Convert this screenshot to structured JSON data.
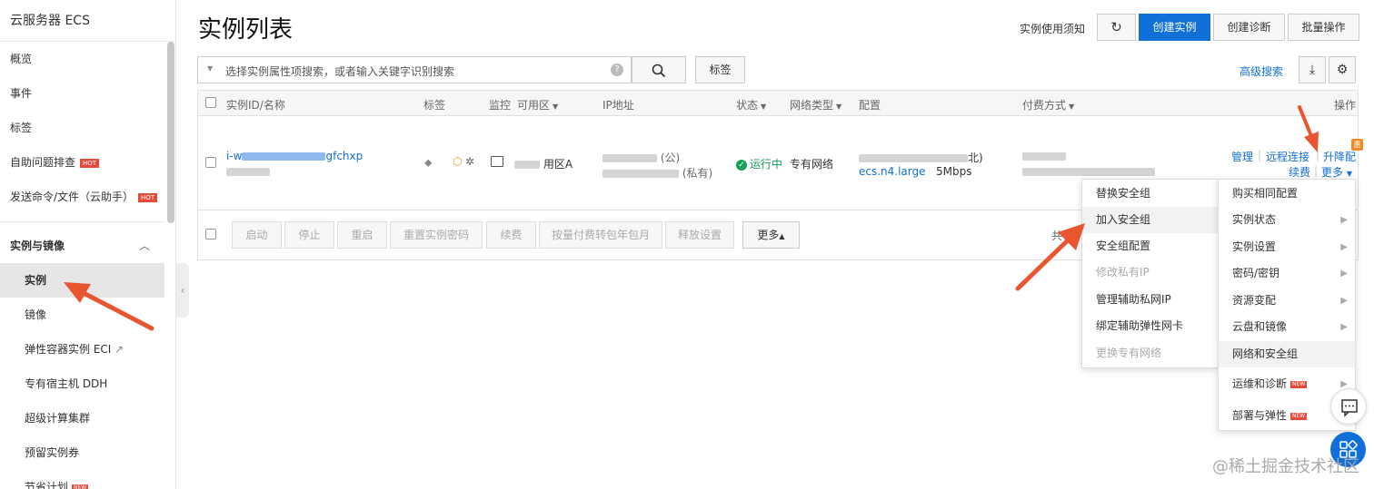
{
  "sidebar": {
    "title": "云服务器 ECS",
    "items": [
      "概览",
      "事件",
      "标签",
      "自助问题排查",
      "发送命令/文件（云助手）"
    ],
    "hot_badge": "HOT",
    "section": "实例与镜像",
    "sub_items": [
      "实例",
      "镜像",
      "弹性容器实例 ECI",
      "专有宿主机 DDH",
      "超级计算集群",
      "预留实例券",
      "节省计划"
    ],
    "new_badge": "NEW"
  },
  "header": {
    "title": "实例列表",
    "notice_link": "实例使用须知",
    "refresh_icon": "↻",
    "create_button": "创建实例",
    "diagnose_button": "创建诊断",
    "batch_button": "批量操作"
  },
  "search": {
    "placeholder": "选择实例属性项搜索，或者输入关键字识别搜索",
    "help_icon": "?",
    "tag_button": "标签",
    "advanced_link": "高级搜索"
  },
  "table": {
    "headers": {
      "id_name": "实例ID/名称",
      "tags": "标签",
      "monitor": "监控",
      "zone": "可用区",
      "ip": "IP地址",
      "status": "状态",
      "network": "网络类型",
      "config": "配置",
      "billing": "付费方式",
      "actions": "操作"
    },
    "row": {
      "id_prefix": "i-w",
      "id_suffix": "gfchxp",
      "zone_suffix": "用区A",
      "ip_public": "(公)",
      "ip_private": "(私有)",
      "status": "运行中",
      "network": "专有网络",
      "config_suffix": "北)",
      "instance_type": "ecs.n4.large",
      "bandwidth": "5Mbps",
      "actions": {
        "manage": "管理",
        "remote": "远程连接",
        "upgrade": "升降配",
        "renew": "续费",
        "more": "更多"
      },
      "promo_badge": "惠"
    },
    "footer_buttons": [
      "启动",
      "停止",
      "重启",
      "重置实例密码",
      "续费",
      "按量付费转包年包月",
      "释放设置"
    ],
    "footer_more": "更多",
    "total_prefix": "共"
  },
  "submenu_security": {
    "items": [
      "替换安全组",
      "加入安全组",
      "安全组配置",
      "修改私有IP",
      "管理辅助私网IP",
      "绑定辅助弹性网卡",
      "更换专有网络"
    ],
    "highlighted": "加入安全组",
    "disabled": [
      "修改私有IP",
      "更换专有网络"
    ]
  },
  "more_menu": {
    "items": [
      "购买相同配置",
      "实例状态",
      "实例设置",
      "密码/密钥",
      "资源变配",
      "云盘和镜像",
      "网络和安全组",
      "运维和诊断",
      "部署与弹性"
    ],
    "with_arrow": [
      false,
      true,
      true,
      true,
      true,
      true,
      false,
      true,
      false
    ]
  },
  "watermark": "@稀土掘金技术社区",
  "colors": {
    "primary": "#1170d8",
    "arrow": "#e8552f",
    "success": "#18a058",
    "hot": "#e54a3b"
  }
}
